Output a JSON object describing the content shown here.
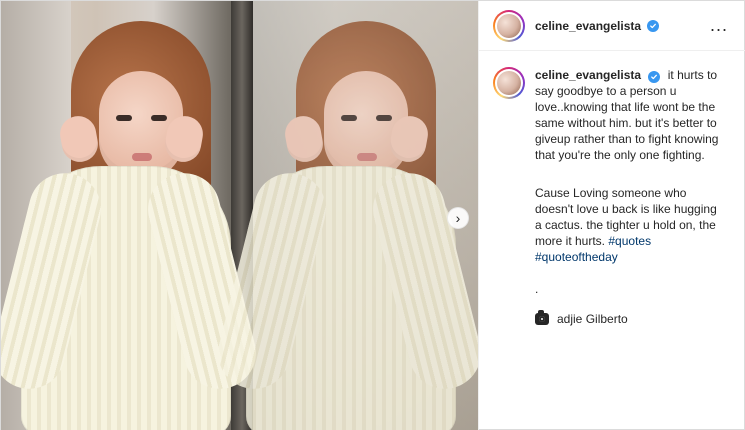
{
  "header": {
    "username": "celine_evangelista",
    "verified": true,
    "more_label": "..."
  },
  "media": {
    "next_label": "›"
  },
  "caption": {
    "username": "celine_evangelista",
    "verified": true,
    "paragraph_1": "it hurts to say goodbye to a person u love..knowing that life wont be the same without him. but it's better to giveup rather than to fight knowing that you're the only one fighting.",
    "paragraph_2_prefix": "Cause Loving someone who doesn't love u back is like hugging a cactus. the tighter u hold on, the more it hurts.",
    "hashtags": [
      "#quotes",
      "#quoteoftheday"
    ],
    "dot": ".",
    "credit": {
      "name": "adjie Gilberto"
    }
  },
  "colors": {
    "accent_blue": "#3897f0",
    "hashtag_blue": "#00376b",
    "text": "#262626",
    "border": "#dbdbdb"
  },
  "icons": {
    "verified": "verified-badge",
    "more": "more-horizontal",
    "next": "chevron-right",
    "camera": "camera"
  }
}
